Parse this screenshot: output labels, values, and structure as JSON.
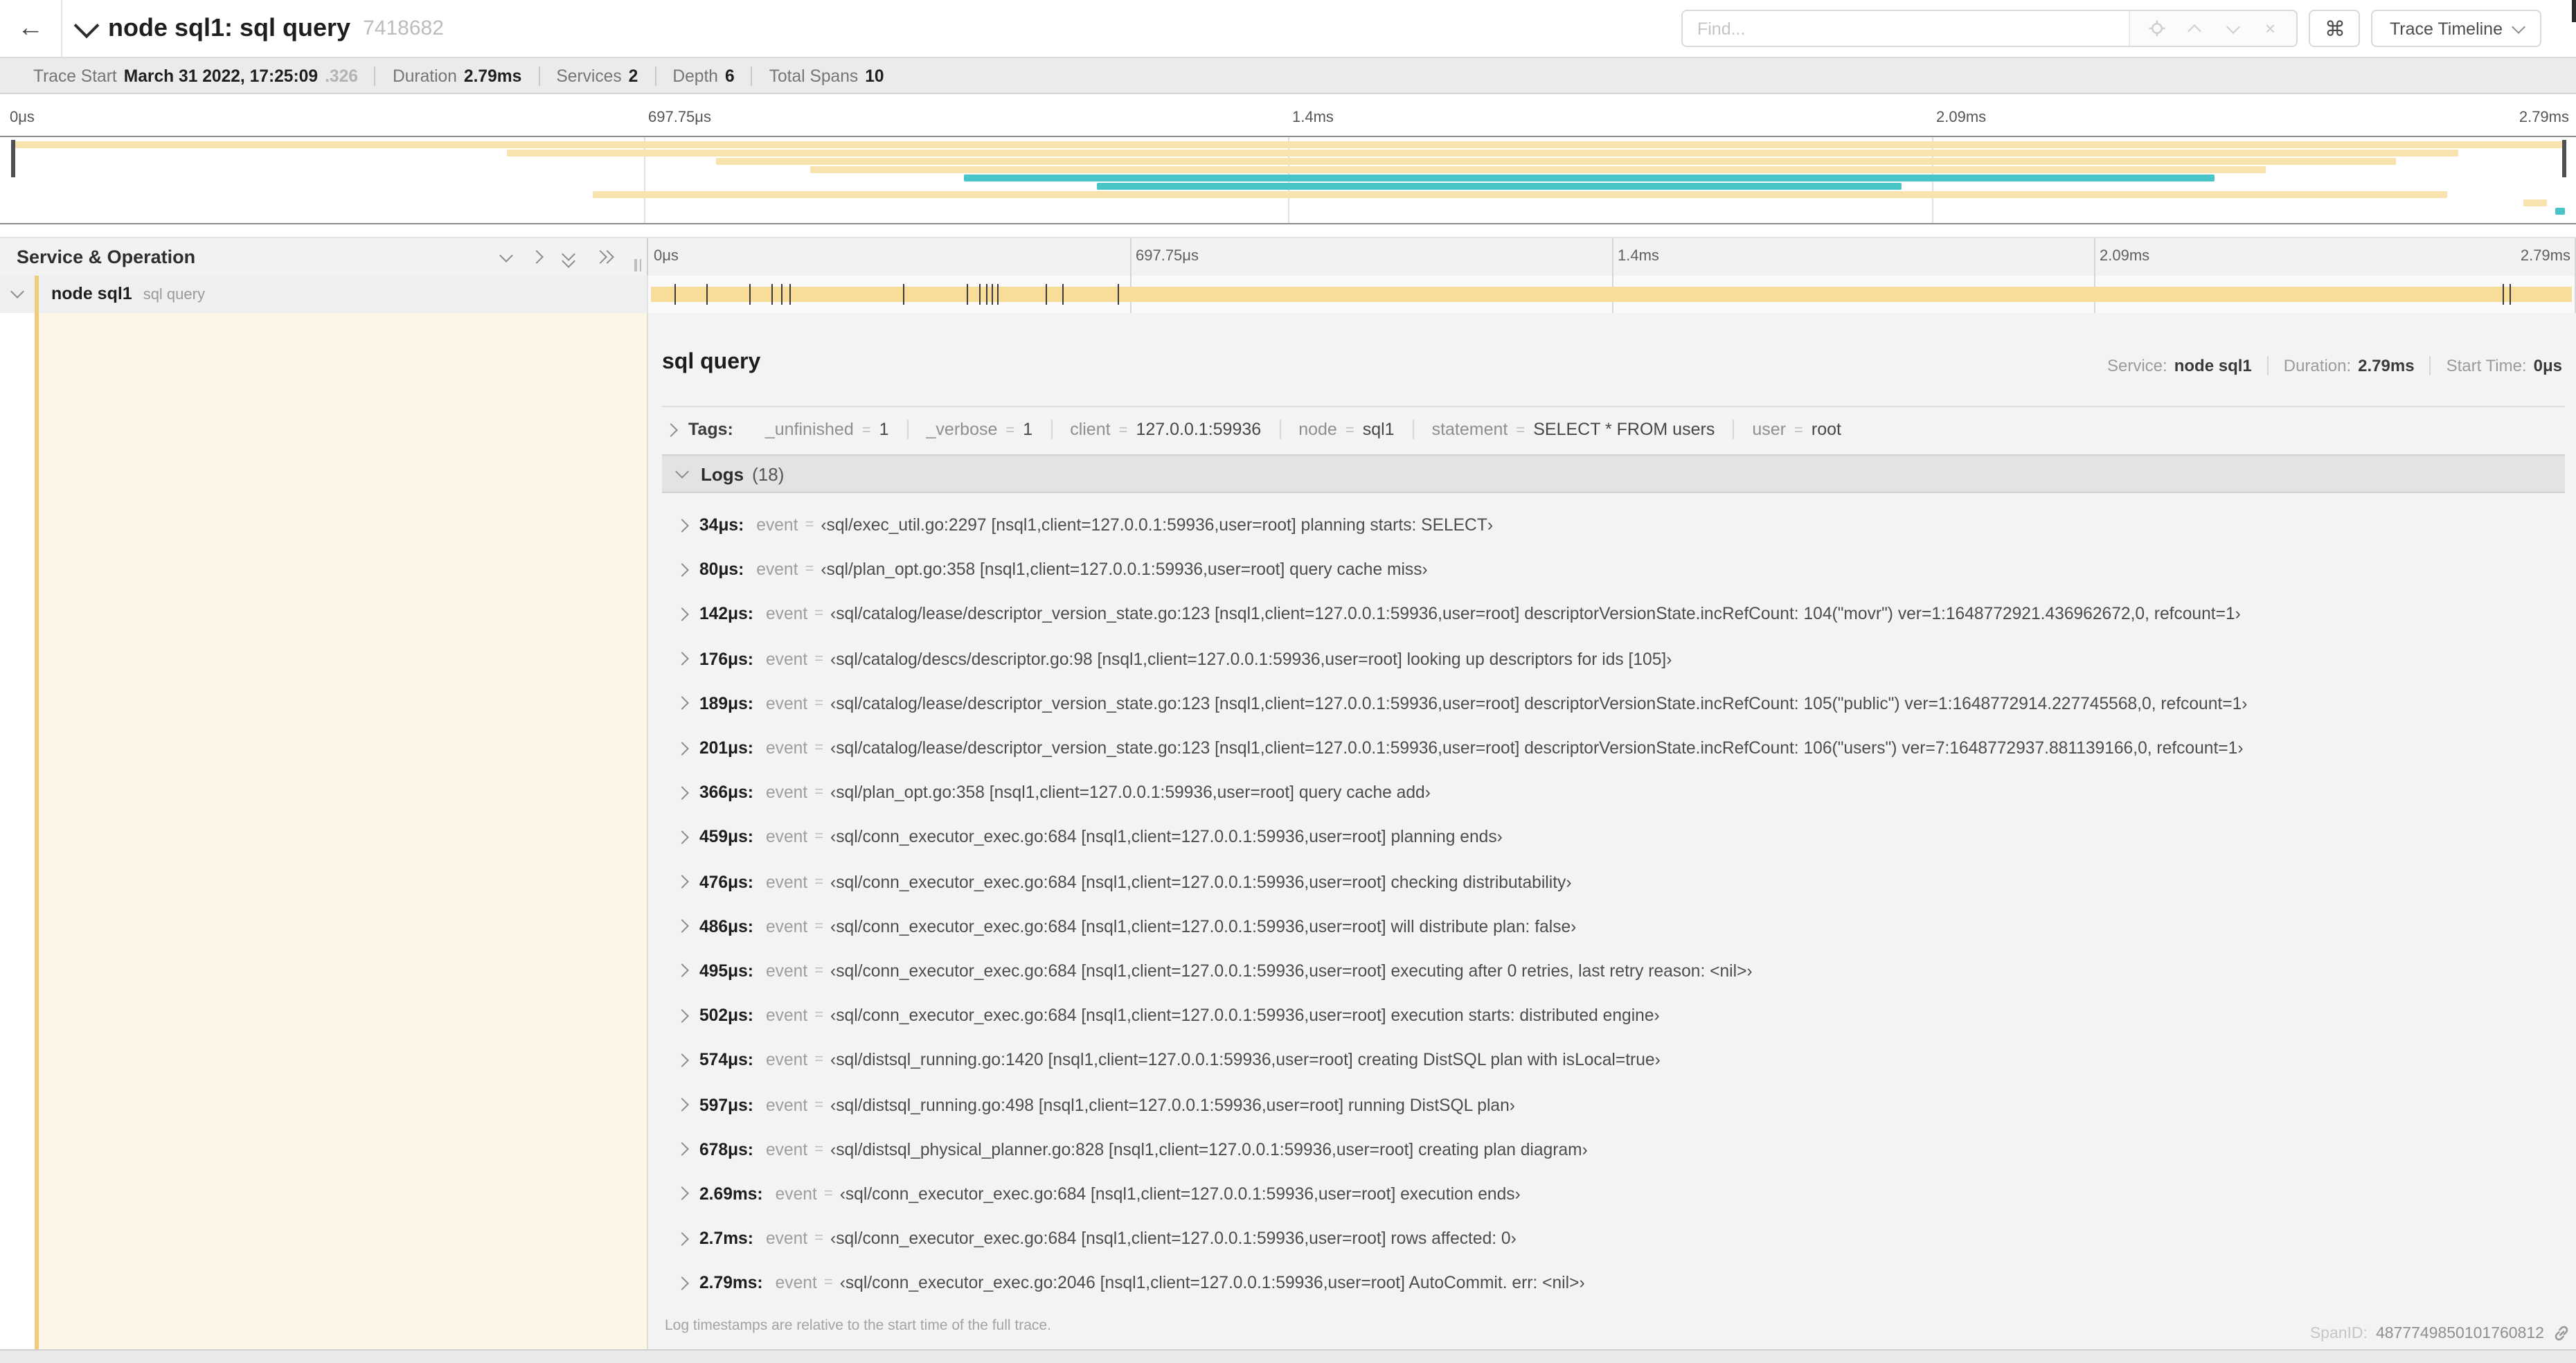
{
  "colors": {
    "tan": "#f8e2ae",
    "teal": "#49c5c8",
    "bar_tan": "#f7dc9a",
    "accent": "#f1cb7c",
    "cream": "#fdf6e7"
  },
  "header": {
    "back_icon": "←",
    "title": "node sql1: sql query",
    "trace_id": "7418682",
    "find_placeholder": "Find...",
    "clear_icon": "×",
    "command_icon": "⌘",
    "view_button": "Trace Timeline"
  },
  "stats": [
    {
      "label": "Trace Start",
      "value": "March 31 2022, 17:25:09",
      "suffix": ".326"
    },
    {
      "label": "Duration",
      "value": "2.79ms"
    },
    {
      "label": "Services",
      "value": "2"
    },
    {
      "label": "Depth",
      "value": "6"
    },
    {
      "label": "Total Spans",
      "value": "10"
    }
  ],
  "time_ticks": [
    "0μs",
    "697.75μs",
    "1.4ms",
    "2.09ms",
    "2.79ms"
  ],
  "minimap": {
    "spans": [
      {
        "row": 0,
        "start": 0,
        "end": 100,
        "color": "tan"
      },
      {
        "row": 1,
        "start": 19.4,
        "end": 95.8,
        "color": "tan"
      },
      {
        "row": 2,
        "start": 27.6,
        "end": 93.4,
        "color": "tan"
      },
      {
        "row": 3,
        "start": 31.3,
        "end": 88.3,
        "color": "tan"
      },
      {
        "row": 4,
        "start": 37.3,
        "end": 86.3,
        "color": "teal"
      },
      {
        "row": 5,
        "start": 42.5,
        "end": 74.0,
        "color": "teal"
      },
      {
        "row": 6,
        "start": 22.8,
        "end": 95.4,
        "color": "tan"
      },
      {
        "row": 7,
        "start": 98.4,
        "end": 99.3,
        "color": "tan"
      },
      {
        "row": 8,
        "start": 99.6,
        "end": 100,
        "color": "teal"
      }
    ]
  },
  "timeline": {
    "left_header": "Service & Operation",
    "row": {
      "service": "node sql1",
      "operation": "sql query"
    }
  },
  "detail": {
    "title": "sql query",
    "meta": [
      {
        "label": "Service:",
        "value": "node sql1"
      },
      {
        "label": "Duration:",
        "value": "2.79ms"
      },
      {
        "label": "Start Time:",
        "value": "0μs"
      }
    ],
    "tags_label": "Tags:",
    "eq": "=",
    "tags": [
      {
        "key": "_unfinished",
        "value": "1"
      },
      {
        "key": "_verbose",
        "value": "1"
      },
      {
        "key": "client",
        "value": "127.0.0.1:59936"
      },
      {
        "key": "node",
        "value": "sql1"
      },
      {
        "key": "statement",
        "value": "SELECT * FROM users"
      },
      {
        "key": "user",
        "value": "root"
      }
    ],
    "logs_label": "Logs",
    "logs_count": "(18)",
    "log_field": "event",
    "logs": [
      {
        "time": "34μs:",
        "value": "‹sql/exec_util.go:2297 [nsql1,client=127.0.0.1:59936,user=root] planning starts: SELECT›"
      },
      {
        "time": "80μs:",
        "value": "‹sql/plan_opt.go:358 [nsql1,client=127.0.0.1:59936,user=root] query cache miss›"
      },
      {
        "time": "142μs:",
        "value": "‹sql/catalog/lease/descriptor_version_state.go:123 [nsql1,client=127.0.0.1:59936,user=root] descriptorVersionState.incRefCount: 104(\"movr\") ver=1:1648772921.436962672,0, refcount=1›"
      },
      {
        "time": "176μs:",
        "value": "‹sql/catalog/descs/descriptor.go:98 [nsql1,client=127.0.0.1:59936,user=root] looking up descriptors for ids [105]›"
      },
      {
        "time": "189μs:",
        "value": "‹sql/catalog/lease/descriptor_version_state.go:123 [nsql1,client=127.0.0.1:59936,user=root] descriptorVersionState.incRefCount: 105(\"public\") ver=1:1648772914.227745568,0, refcount=1›"
      },
      {
        "time": "201μs:",
        "value": "‹sql/catalog/lease/descriptor_version_state.go:123 [nsql1,client=127.0.0.1:59936,user=root] descriptorVersionState.incRefCount: 106(\"users\") ver=7:1648772937.881139166,0, refcount=1›"
      },
      {
        "time": "366μs:",
        "value": "‹sql/plan_opt.go:358 [nsql1,client=127.0.0.1:59936,user=root] query cache add›"
      },
      {
        "time": "459μs:",
        "value": "‹sql/conn_executor_exec.go:684 [nsql1,client=127.0.0.1:59936,user=root] planning ends›"
      },
      {
        "time": "476μs:",
        "value": "‹sql/conn_executor_exec.go:684 [nsql1,client=127.0.0.1:59936,user=root] checking distributability›"
      },
      {
        "time": "486μs:",
        "value": "‹sql/conn_executor_exec.go:684 [nsql1,client=127.0.0.1:59936,user=root] will distribute plan: false›"
      },
      {
        "time": "495μs:",
        "value": "‹sql/conn_executor_exec.go:684 [nsql1,client=127.0.0.1:59936,user=root] executing after 0 retries, last retry reason: <nil>›"
      },
      {
        "time": "502μs:",
        "value": "‹sql/conn_executor_exec.go:684 [nsql1,client=127.0.0.1:59936,user=root] execution starts: distributed engine›"
      },
      {
        "time": "574μs:",
        "value": "‹sql/distsql_running.go:1420 [nsql1,client=127.0.0.1:59936,user=root] creating DistSQL plan with isLocal=true›"
      },
      {
        "time": "597μs:",
        "value": "‹sql/distsql_running.go:498 [nsql1,client=127.0.0.1:59936,user=root] running DistSQL plan›"
      },
      {
        "time": "678μs:",
        "value": "‹sql/distsql_physical_planner.go:828 [nsql1,client=127.0.0.1:59936,user=root] creating plan diagram›"
      },
      {
        "time": "2.69ms:",
        "value": "‹sql/conn_executor_exec.go:684 [nsql1,client=127.0.0.1:59936,user=root] execution ends›"
      },
      {
        "time": "2.7ms:",
        "value": "‹sql/conn_executor_exec.go:684 [nsql1,client=127.0.0.1:59936,user=root] rows affected: 0›"
      },
      {
        "time": "2.79ms:",
        "value": "‹sql/conn_executor_exec.go:2046 [nsql1,client=127.0.0.1:59936,user=root] AutoCommit. err: <nil>›"
      }
    ],
    "note": "Log timestamps are relative to the start time of the full trace.",
    "spanid_label": "SpanID:",
    "spanid": "4877749850101760812"
  }
}
